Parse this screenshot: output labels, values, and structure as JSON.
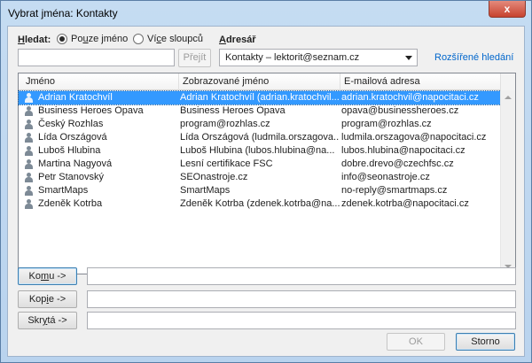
{
  "window": {
    "title": "Vybrat jména: Kontakty",
    "close_glyph": "x"
  },
  "search": {
    "label_pre": "",
    "label_key": "H",
    "label_post": "ledat:",
    "value": "",
    "find_button": "Přejít",
    "options": [
      {
        "pre": "Po",
        "key": "u",
        "post": "ze jméno",
        "selected": true
      },
      {
        "pre": "Ví",
        "key": "c",
        "post": "e sloupců",
        "selected": false
      }
    ]
  },
  "address_book": {
    "label_key": "A",
    "label_post": "dresář",
    "selected": "Kontakty – lektorit@seznam.cz",
    "advanced_link": "Rozšířené hledání"
  },
  "list": {
    "columns": [
      "Jméno",
      "Zobrazované jméno",
      "E-mailová adresa"
    ],
    "rows": [
      {
        "name": "Adrian Kratochvíl",
        "display": "Adrian Kratochvíl (adrian.kratochvil...",
        "email": "adrian.kratochvil@napocitaci.cz",
        "selected": true
      },
      {
        "name": "Business Heroes Opava",
        "display": "Business Heroes Opava",
        "email": "opava@businessheroes.cz"
      },
      {
        "name": "Český Rozhlas",
        "display": "program@rozhlas.cz",
        "email": "program@rozhlas.cz"
      },
      {
        "name": "Lída Országová",
        "display": "Lída Országová (ludmila.orszagova...",
        "email": "ludmila.orszagova@napocitaci.cz"
      },
      {
        "name": "Luboš Hlubina",
        "display": "Luboš Hlubina (lubos.hlubina@na...",
        "email": "lubos.hlubina@napocitaci.cz"
      },
      {
        "name": "Martina Nagyová",
        "display": "Lesní certifikace FSC",
        "email": "dobre.drevo@czechfsc.cz"
      },
      {
        "name": "Petr Stanovský",
        "display": "SEOnastroje.cz",
        "email": "info@seonastroje.cz"
      },
      {
        "name": "SmartMaps",
        "display": "SmartMaps",
        "email": "no-reply@smartmaps.cz"
      },
      {
        "name": "Zdeněk Kotrba",
        "display": "Zdeněk Kotrba (zdenek.kotrba@na...",
        "email": "zdenek.kotrba@napocitaci.cz"
      }
    ]
  },
  "recipients": {
    "to": {
      "pre": "Ko",
      "key": "m",
      "post": "u ->",
      "value": ""
    },
    "cc": {
      "pre": "Kop",
      "key": "i",
      "post": "e ->",
      "value": ""
    },
    "bcc": {
      "pre": "Skr",
      "key": "y",
      "post": "tá ->",
      "value": ""
    }
  },
  "footer": {
    "ok": "OK",
    "cancel": "Storno"
  },
  "colors": {
    "selection": "#3399ff",
    "link": "#0066cc",
    "titlebar": "#c5dcf2",
    "close": "#c7432f"
  },
  "icons": [
    "close-icon",
    "contact-icon",
    "chevron-down-icon",
    "scroll-up-icon",
    "scroll-down-icon"
  ]
}
